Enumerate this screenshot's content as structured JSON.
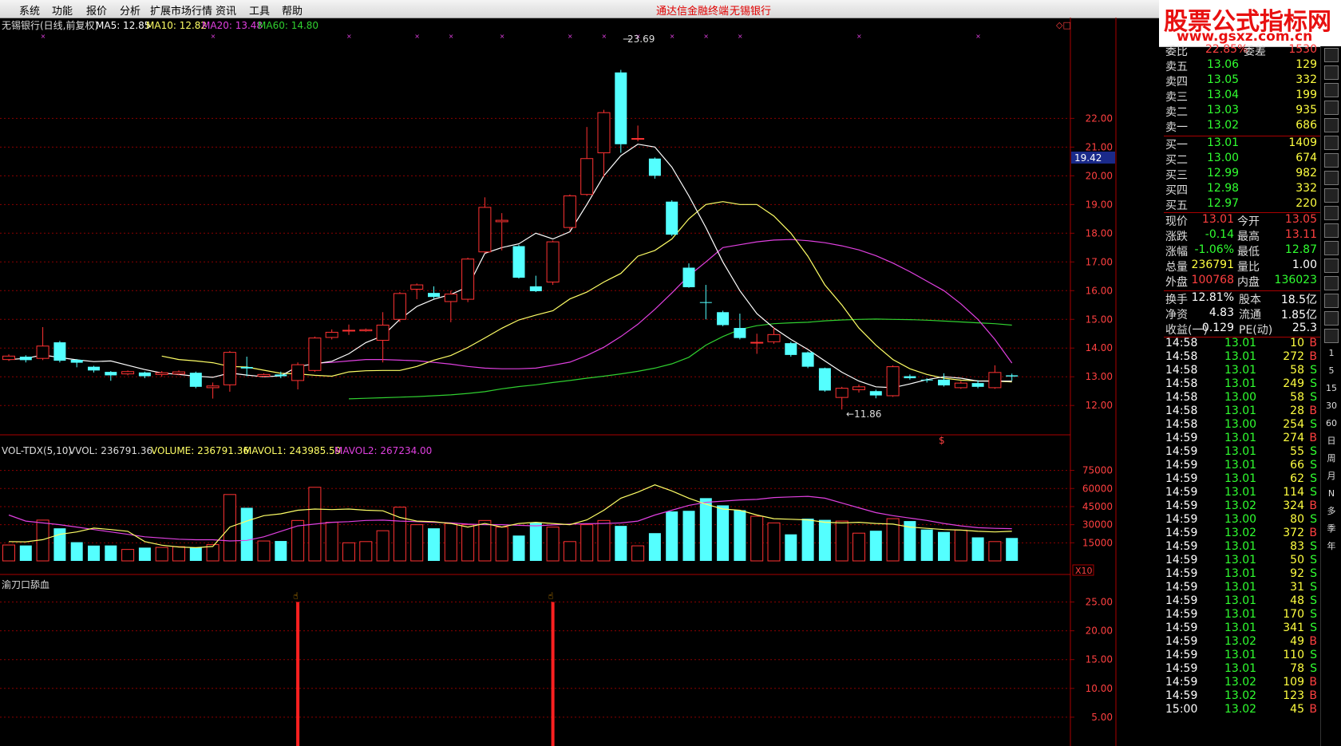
{
  "menu": {
    "items": [
      "系统",
      "功能",
      "报价",
      "分析",
      "扩展市场行情",
      "资讯",
      "工具",
      "帮助"
    ],
    "banner_left": "通达信金融终端",
    "banner_right": "无锡银行"
  },
  "logo": {
    "title": "股票公式指标网",
    "url": "www.gsxz.com.cn"
  },
  "chart_header": {
    "name": "无锡银行(日线,前复权)",
    "ma5": "MA5: 12.85",
    "ma10": "MA10: 12.82",
    "ma20": "MA20: 13.48",
    "ma60": "MA60: 14.80"
  },
  "colors": {
    "up": "#ff3232",
    "down": "#54ffff",
    "ma5": "#ffffff",
    "ma10": "#ffff66",
    "ma20": "#e040e0",
    "ma60": "#30d030",
    "grid": "#8b0000",
    "axis_text": "#ff4040"
  },
  "price_axis": [
    "22.00",
    "21.00",
    "20.00",
    "19.00",
    "18.00",
    "17.00",
    "16.00",
    "15.00",
    "14.00",
    "13.00",
    "12.00"
  ],
  "price_cursor": "19.42",
  "annotations": {
    "high": "23.69",
    "low": "←11.86",
    "marker": "$"
  },
  "vol_header": {
    "name": "VOL-TDX(5,10)",
    "vvol": "VVOL: 236791.36",
    "volume": "VOLUME: 236791.36",
    "mavol1": "MAVOL1: 243985.59",
    "mavol2": "MAVOL2: 267234.00"
  },
  "vol_axis": [
    "75000",
    "60000",
    "45000",
    "30000",
    "15000"
  ],
  "vol_unit": "X10",
  "ind_header": {
    "name": "渝刀口舔血"
  },
  "ind_axis": [
    "25.00",
    "20.00",
    "15.00",
    "10.00",
    "5.00"
  ],
  "chart_data": {
    "type": "candlestick",
    "candles": [
      {
        "o": 13.6,
        "c": 13.72,
        "h": 13.78,
        "l": 13.55
      },
      {
        "o": 13.7,
        "c": 13.58,
        "h": 13.75,
        "l": 13.5
      },
      {
        "o": 13.64,
        "c": 14.07,
        "h": 14.73,
        "l": 13.58
      },
      {
        "o": 14.2,
        "c": 13.56,
        "h": 14.25,
        "l": 13.5
      },
      {
        "o": 13.59,
        "c": 13.49,
        "h": 13.62,
        "l": 13.33
      },
      {
        "o": 13.35,
        "c": 13.22,
        "h": 13.38,
        "l": 13.15
      },
      {
        "o": 13.17,
        "c": 13.05,
        "h": 13.2,
        "l": 12.86
      },
      {
        "o": 13.1,
        "c": 13.18,
        "h": 13.22,
        "l": 13.05
      },
      {
        "o": 13.15,
        "c": 13.02,
        "h": 13.18,
        "l": 12.95
      },
      {
        "o": 13.08,
        "c": 13.14,
        "h": 13.2,
        "l": 13.0
      },
      {
        "o": 13.1,
        "c": 13.17,
        "h": 13.22,
        "l": 13.05
      },
      {
        "o": 13.14,
        "c": 12.65,
        "h": 13.18,
        "l": 12.6
      },
      {
        "o": 12.62,
        "c": 12.68,
        "h": 12.8,
        "l": 12.24
      },
      {
        "o": 12.72,
        "c": 13.85,
        "h": 13.9,
        "l": 12.48
      },
      {
        "o": 13.34,
        "c": 13.29,
        "h": 13.7,
        "l": 13.02
      },
      {
        "o": 13.02,
        "c": 13.08,
        "h": 13.12,
        "l": 12.98
      },
      {
        "o": 13.08,
        "c": 13.02,
        "h": 13.18,
        "l": 12.95
      },
      {
        "o": 12.87,
        "c": 13.42,
        "h": 13.5,
        "l": 12.56
      },
      {
        "o": 13.22,
        "c": 14.35,
        "h": 14.4,
        "l": 13.17
      },
      {
        "o": 14.37,
        "c": 14.55,
        "h": 14.65,
        "l": 14.3
      },
      {
        "o": 14.6,
        "c": 14.62,
        "h": 14.82,
        "l": 14.46
      },
      {
        "o": 14.6,
        "c": 14.64,
        "h": 14.68,
        "l": 14.57
      },
      {
        "o": 14.27,
        "c": 14.8,
        "h": 15.25,
        "l": 13.5
      },
      {
        "o": 15.0,
        "c": 15.9,
        "h": 15.95,
        "l": 14.9
      },
      {
        "o": 16.05,
        "c": 16.2,
        "h": 16.25,
        "l": 15.7
      },
      {
        "o": 15.92,
        "c": 15.78,
        "h": 16.15,
        "l": 15.72
      },
      {
        "o": 15.62,
        "c": 15.88,
        "h": 16.0,
        "l": 14.9
      },
      {
        "o": 15.7,
        "c": 17.1,
        "h": 17.15,
        "l": 15.6
      },
      {
        "o": 17.35,
        "c": 18.9,
        "h": 19.25,
        "l": 17.3
      },
      {
        "o": 18.4,
        "c": 18.45,
        "h": 18.7,
        "l": 17.4
      },
      {
        "o": 17.55,
        "c": 16.45,
        "h": 17.6,
        "l": 16.42
      },
      {
        "o": 16.15,
        "c": 15.98,
        "h": 16.52,
        "l": 15.95
      },
      {
        "o": 16.3,
        "c": 17.7,
        "h": 17.75,
        "l": 16.2
      },
      {
        "o": 18.2,
        "c": 19.3,
        "h": 19.35,
        "l": 18.1
      },
      {
        "o": 19.35,
        "c": 20.6,
        "h": 21.7,
        "l": 19.3
      },
      {
        "o": 20.8,
        "c": 22.2,
        "h": 22.3,
        "l": 19.95
      },
      {
        "o": 23.6,
        "c": 21.1,
        "h": 23.69,
        "l": 20.8
      },
      {
        "o": 21.3,
        "c": 21.3,
        "h": 21.75,
        "l": 21.2
      },
      {
        "o": 20.6,
        "c": 20.0,
        "h": 20.64,
        "l": 19.9
      },
      {
        "o": 19.1,
        "c": 17.95,
        "h": 19.15,
        "l": 17.9
      },
      {
        "o": 16.8,
        "c": 16.12,
        "h": 16.95,
        "l": 16.1
      },
      {
        "o": 15.6,
        "c": 15.58,
        "h": 16.2,
        "l": 15.0
      },
      {
        "o": 15.25,
        "c": 14.8,
        "h": 15.3,
        "l": 14.76
      },
      {
        "o": 14.7,
        "c": 14.35,
        "h": 15.2,
        "l": 14.3
      },
      {
        "o": 14.2,
        "c": 14.2,
        "h": 14.5,
        "l": 13.8
      },
      {
        "o": 14.22,
        "c": 14.47,
        "h": 14.73,
        "l": 14.15
      },
      {
        "o": 14.17,
        "c": 13.76,
        "h": 14.22,
        "l": 13.7
      },
      {
        "o": 13.85,
        "c": 13.35,
        "h": 13.88,
        "l": 13.3
      },
      {
        "o": 13.3,
        "c": 12.52,
        "h": 13.32,
        "l": 12.48
      },
      {
        "o": 12.28,
        "c": 12.6,
        "h": 12.65,
        "l": 11.86
      },
      {
        "o": 12.55,
        "c": 12.65,
        "h": 12.73,
        "l": 12.45
      },
      {
        "o": 12.5,
        "c": 12.35,
        "h": 12.55,
        "l": 12.25
      },
      {
        "o": 12.34,
        "c": 13.35,
        "h": 13.4,
        "l": 12.3
      },
      {
        "o": 13.02,
        "c": 12.95,
        "h": 13.08,
        "l": 12.9
      },
      {
        "o": 12.9,
        "c": 12.88,
        "h": 12.95,
        "l": 12.8
      },
      {
        "o": 12.9,
        "c": 12.7,
        "h": 13.12,
        "l": 12.66
      },
      {
        "o": 12.62,
        "c": 12.78,
        "h": 12.85,
        "l": 12.58
      },
      {
        "o": 12.78,
        "c": 12.65,
        "h": 12.88,
        "l": 12.6
      },
      {
        "o": 12.62,
        "c": 13.15,
        "h": 13.4,
        "l": 12.58
      },
      {
        "o": 13.05,
        "c": 13.01,
        "h": 13.11,
        "l": 12.87
      }
    ],
    "volumes": [
      13200,
      12800,
      33800,
      27000,
      15500,
      12700,
      12800,
      9500,
      11000,
      11200,
      11800,
      11000,
      13500,
      55000,
      44000,
      16500,
      16500,
      33500,
      61000,
      32000,
      15000,
      16000,
      25000,
      44500,
      30000,
      27000,
      31000,
      30000,
      33500,
      28000,
      21000,
      32000,
      28000,
      16000,
      30000,
      33500,
      29000,
      12500,
      23000,
      41000,
      41500,
      52000,
      46000,
      42000,
      37000,
      31500,
      22000,
      35000,
      34000,
      33000,
      23000,
      25000,
      35000,
      33000,
      26000,
      24000,
      25500,
      19500,
      16000,
      19000,
      34000,
      24000
    ],
    "ma5": [
      13.6,
      13.64,
      13.76,
      13.67,
      13.59,
      13.53,
      13.55,
      13.4,
      13.25,
      13.13,
      13.08,
      13.02,
      12.98,
      13.13,
      13.06,
      13.0,
      13.03,
      13.36,
      13.45,
      13.54,
      13.8,
      14.19,
      14.43,
      15.0,
      15.45,
      15.7,
      15.87,
      16.13,
      17.3,
      17.5,
      17.63,
      18.0,
      17.8,
      18.05,
      19.0,
      20.0,
      20.7,
      21.1,
      21.0,
      20.3,
      19.3,
      18.2,
      17.0,
      16.0,
      15.2,
      14.7,
      14.3,
      13.95,
      13.55,
      13.16,
      12.85,
      12.65,
      12.62,
      12.75,
      12.9,
      13.0,
      12.95,
      12.85,
      12.85,
      12.85
    ],
    "ma10": [
      13.72,
      13.6,
      13.55,
      13.49,
      13.36,
      13.34,
      13.23,
      13.12,
      13.1,
      13.05,
      13.02,
      13.17,
      13.21,
      13.22,
      13.22,
      13.36,
      13.58,
      13.74,
      14.02,
      14.35,
      14.69,
      14.98,
      15.15,
      15.3,
      15.71,
      15.95,
      16.3,
      16.6,
      17.2,
      17.4,
      17.8,
      18.5,
      19.0,
      19.1,
      19.0,
      19.0,
      18.6,
      18.0,
      17.2,
      16.2,
      15.5,
      14.7,
      14.1,
      13.6,
      13.28,
      13.08,
      12.95,
      12.88,
      12.86,
      12.85,
      12.82
    ],
    "ma20": [
      13.47,
      13.5,
      13.55,
      13.6,
      13.6,
      13.58,
      13.56,
      13.5,
      13.44,
      13.36,
      13.3,
      13.28,
      13.28,
      13.3,
      13.4,
      13.51,
      13.74,
      14.03,
      14.4,
      14.83,
      15.35,
      15.92,
      16.52,
      17.0,
      17.5,
      17.6,
      17.7,
      17.76,
      17.78,
      17.74,
      17.67,
      17.56,
      17.42,
      17.22,
      16.96,
      16.66,
      16.33,
      16.0,
      15.54,
      15.0,
      14.3,
      13.48
    ],
    "ma60": [
      12.23,
      12.25,
      12.27,
      12.29,
      12.31,
      12.34,
      12.37,
      12.42,
      12.48,
      12.58,
      12.66,
      12.72,
      12.8,
      12.87,
      12.95,
      13.02,
      13.1,
      13.19,
      13.3,
      13.45,
      13.68,
      14.1,
      14.4,
      14.65,
      14.78,
      14.85,
      14.88,
      14.9,
      14.95,
      14.98,
      15.0,
      15.01,
      15.0,
      14.99,
      14.97,
      14.94,
      14.91,
      14.88,
      14.85,
      14.8
    ],
    "mavol1": [
      16000,
      15800,
      17600,
      22000,
      24000,
      27200,
      26000,
      24500,
      16000,
      13000,
      11500,
      11000,
      12000,
      28000,
      33000,
      37500,
      39000,
      42000,
      43000,
      42500,
      43000,
      42000,
      41500,
      36000,
      33000,
      32500,
      31000,
      28000,
      31000,
      28000,
      31000,
      32000,
      31000,
      30000,
      34000,
      42000,
      52000,
      57000,
      63000,
      58000,
      52000,
      47000,
      43000,
      42000,
      38000,
      35000,
      34500,
      34000,
      32000,
      31500,
      32000,
      31000,
      30500,
      28000,
      27000,
      26000,
      25500,
      24500,
      24000,
      24500
    ],
    "mavol2": [
      38000,
      33000,
      31500,
      30000,
      28000,
      26000,
      24000,
      22000,
      20000,
      19000,
      18000,
      17500,
      17500,
      16500,
      17000,
      20000,
      24500,
      29000,
      30500,
      32000,
      32500,
      33500,
      33800,
      33000,
      32500,
      32000,
      31500,
      30500,
      30000,
      30000,
      29500,
      29000,
      29800,
      30500,
      30800,
      31000,
      31500,
      33000,
      38000,
      42000,
      46000,
      48500,
      49500,
      50500,
      51000,
      52500,
      53000,
      53500,
      52000,
      48000,
      44000,
      40000,
      37500,
      35500,
      33500,
      31000,
      29000,
      27500,
      27000,
      26700
    ],
    "signals": [
      {
        "index": 17,
        "value": 25
      },
      {
        "index": 32,
        "value": 25
      }
    ],
    "ylim_price": [
      11.2,
      24.4
    ]
  },
  "quote": {
    "top_partial": {
      "label": "委比",
      "value": "22.85%",
      "label2": "委差",
      "value2": "1530"
    },
    "asks": [
      {
        "label": "卖五",
        "price": "13.06",
        "vol": "129"
      },
      {
        "label": "卖四",
        "price": "13.05",
        "vol": "332"
      },
      {
        "label": "卖三",
        "price": "13.04",
        "vol": "199"
      },
      {
        "label": "卖二",
        "price": "13.03",
        "vol": "935"
      },
      {
        "label": "卖一",
        "price": "13.02",
        "vol": "686"
      }
    ],
    "bids": [
      {
        "label": "买一",
        "price": "13.01",
        "vol": "1409"
      },
      {
        "label": "买二",
        "price": "13.00",
        "vol": "674"
      },
      {
        "label": "买三",
        "price": "12.99",
        "vol": "982"
      },
      {
        "label": "买四",
        "price": "12.98",
        "vol": "332"
      },
      {
        "label": "买五",
        "price": "12.97",
        "vol": "220"
      }
    ],
    "stats": [
      {
        "l1": "现价",
        "v1": "13.01",
        "c1": "#ff4040",
        "l2": "今开",
        "v2": "13.05",
        "c2": "#ff4040"
      },
      {
        "l1": "涨跌",
        "v1": "-0.14",
        "c1": "#30ff30",
        "l2": "最高",
        "v2": "13.11",
        "c2": "#ff4040"
      },
      {
        "l1": "涨幅",
        "v1": "-1.06%",
        "c1": "#30ff30",
        "l2": "最低",
        "v2": "12.87",
        "c2": "#30ff30"
      },
      {
        "l1": "总量",
        "v1": "236791",
        "c1": "#ffff40",
        "l2": "量比",
        "v2": "1.00",
        "c2": "#ffffff"
      },
      {
        "l1": "外盘",
        "v1": "100768",
        "c1": "#ff4040",
        "l2": "内盘",
        "v2": "136023",
        "c2": "#30ff30"
      }
    ],
    "fin": [
      {
        "l1": "换手",
        "v1": "12.81%",
        "l2": "股本",
        "v2": "18.5亿"
      },
      {
        "l1": "净资",
        "v1": "4.83",
        "l2": "流通",
        "v2": "1.85亿"
      },
      {
        "l1": "收益(一)",
        "v1": "0.129",
        "l2": "PE(动)",
        "v2": "25.3"
      }
    ],
    "ticks": [
      {
        "t": "14:58",
        "p": "13.01",
        "v": "10",
        "d": "B"
      },
      {
        "t": "14:58",
        "p": "13.01",
        "v": "272",
        "d": "B"
      },
      {
        "t": "14:58",
        "p": "13.01",
        "v": "58",
        "d": "S"
      },
      {
        "t": "14:58",
        "p": "13.01",
        "v": "249",
        "d": "S"
      },
      {
        "t": "14:58",
        "p": "13.00",
        "v": "58",
        "d": "S"
      },
      {
        "t": "14:58",
        "p": "13.01",
        "v": "28",
        "d": "B"
      },
      {
        "t": "14:58",
        "p": "13.00",
        "v": "254",
        "d": "S"
      },
      {
        "t": "14:59",
        "p": "13.01",
        "v": "274",
        "d": "B"
      },
      {
        "t": "14:59",
        "p": "13.01",
        "v": "55",
        "d": "S"
      },
      {
        "t": "14:59",
        "p": "13.01",
        "v": "66",
        "d": "S"
      },
      {
        "t": "14:59",
        "p": "13.01",
        "v": "62",
        "d": "S"
      },
      {
        "t": "14:59",
        "p": "13.01",
        "v": "114",
        "d": "S"
      },
      {
        "t": "14:59",
        "p": "13.02",
        "v": "324",
        "d": "B"
      },
      {
        "t": "14:59",
        "p": "13.00",
        "v": "80",
        "d": "S"
      },
      {
        "t": "14:59",
        "p": "13.02",
        "v": "372",
        "d": "B"
      },
      {
        "t": "14:59",
        "p": "13.01",
        "v": "83",
        "d": "S"
      },
      {
        "t": "14:59",
        "p": "13.01",
        "v": "50",
        "d": "S"
      },
      {
        "t": "14:59",
        "p": "13.01",
        "v": "92",
        "d": "S"
      },
      {
        "t": "14:59",
        "p": "13.01",
        "v": "31",
        "d": "S"
      },
      {
        "t": "14:59",
        "p": "13.01",
        "v": "48",
        "d": "S"
      },
      {
        "t": "14:59",
        "p": "13.01",
        "v": "170",
        "d": "S"
      },
      {
        "t": "14:59",
        "p": "13.01",
        "v": "341",
        "d": "S"
      },
      {
        "t": "14:59",
        "p": "13.02",
        "v": "49",
        "d": "B"
      },
      {
        "t": "14:59",
        "p": "13.01",
        "v": "110",
        "d": "S"
      },
      {
        "t": "14:59",
        "p": "13.01",
        "v": "78",
        "d": "S"
      },
      {
        "t": "14:59",
        "p": "13.02",
        "v": "109",
        "d": "B"
      },
      {
        "t": "14:59",
        "p": "13.02",
        "v": "123",
        "d": "B"
      },
      {
        "t": "15:00",
        "p": "13.02",
        "v": "45",
        "d": "B"
      }
    ]
  },
  "sidebar": {
    "labels": [
      "1",
      "5",
      "15",
      "30",
      "60",
      "日",
      "周",
      "月",
      "N",
      "多",
      "季",
      "年"
    ],
    "icons": [
      "zoom-icon",
      "arrow-down-icon",
      "bar-chart-icon",
      "grid-icon",
      "list-icon",
      "candle-icon",
      "f10-icon",
      "dollar-icon",
      "window-icon",
      "f2-icon",
      "circle-icon",
      "wave-icon",
      "rsi-icon",
      "move-icon",
      "pen-icon",
      "f5-icon",
      "f6-icon"
    ]
  }
}
